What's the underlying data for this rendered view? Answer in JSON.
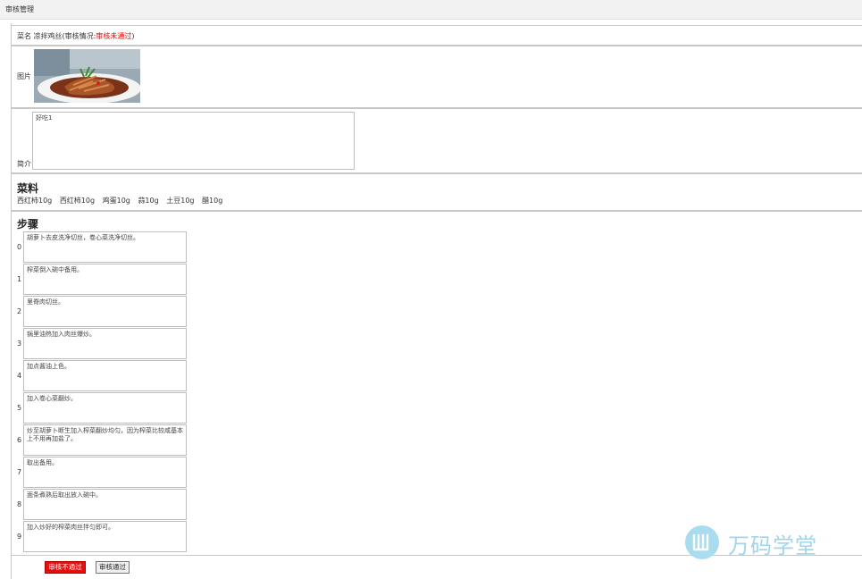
{
  "header": {
    "title": "审核管理"
  },
  "dish": {
    "name_label": "菜名",
    "name": "凉拌鸡丝",
    "status_prefix": "(审核情况:",
    "status": "审核未通过",
    "status_suffix": ")"
  },
  "image": {
    "label": "图片"
  },
  "intro": {
    "label": "简介",
    "text": "好吃1"
  },
  "ingredients": {
    "title": "菜料",
    "items": [
      "西红柿10g",
      "西红柿10g",
      "鸡蛋10g",
      "蒜10g",
      "土豆10g",
      "醋10g"
    ]
  },
  "steps": {
    "title": "步骤",
    "items": [
      {
        "num": "0",
        "text": "胡萝卜去皮洗净切丝，卷心菜洗净切丝。"
      },
      {
        "num": "1",
        "text": "榨菜倒入碗中备用。"
      },
      {
        "num": "2",
        "text": "里脊肉切丝。"
      },
      {
        "num": "3",
        "text": "锅里油热加入肉丝爆炒。"
      },
      {
        "num": "4",
        "text": "加点酱油上色。"
      },
      {
        "num": "5",
        "text": "加入卷心菜翻炒。"
      },
      {
        "num": "6",
        "text": "炒至胡萝卜断生加入榨菜翻炒均匀，因为榨菜比较咸基本上不用再加盐了。"
      },
      {
        "num": "7",
        "text": "取出备用。"
      },
      {
        "num": "8",
        "text": "面条煮熟后取出放入碗中。"
      },
      {
        "num": "9",
        "text": "加入炒好的榨菜肉丝拌匀即可。"
      }
    ]
  },
  "actions": {
    "reject_label": "审核不通过",
    "approve_label": "审核通过"
  },
  "watermark": {
    "text": "万码学堂"
  },
  "colors": {
    "status": "#e00000",
    "reject_button": "#e41010",
    "watermark": "#9fd6ec"
  }
}
